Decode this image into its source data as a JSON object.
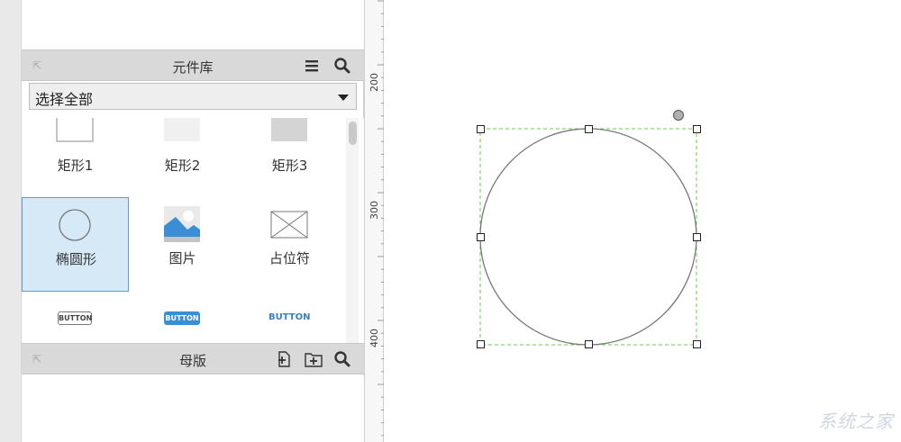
{
  "library_panel": {
    "title": "元件库",
    "selected_library": "选择全部",
    "widgets": [
      {
        "label": "矩形1",
        "icon": "rectangle-1-icon"
      },
      {
        "label": "矩形2",
        "icon": "rectangle-2-icon"
      },
      {
        "label": "矩形3",
        "icon": "rectangle-3-icon"
      },
      {
        "label": "椭圆形",
        "icon": "ellipse-icon",
        "selected": true
      },
      {
        "label": "图片",
        "icon": "image-icon"
      },
      {
        "label": "占位符",
        "icon": "placeholder-icon"
      },
      {
        "button_text": "BUTTON",
        "icon": "button-plain-icon"
      },
      {
        "button_text": "BUTTON",
        "icon": "button-blue-icon"
      },
      {
        "button_text": "BUTTON",
        "icon": "button-link-icon"
      }
    ]
  },
  "masters_panel": {
    "title": "母版"
  },
  "ruler": {
    "labels": [
      "200",
      "300",
      "400"
    ]
  },
  "canvas": {
    "shape": "ellipse"
  },
  "watermark": "系统之家",
  "colors": {
    "selection_blue": "#d6e9f7",
    "accent_blue": "#3a8fd4",
    "selection_outline": "#66cc44"
  }
}
